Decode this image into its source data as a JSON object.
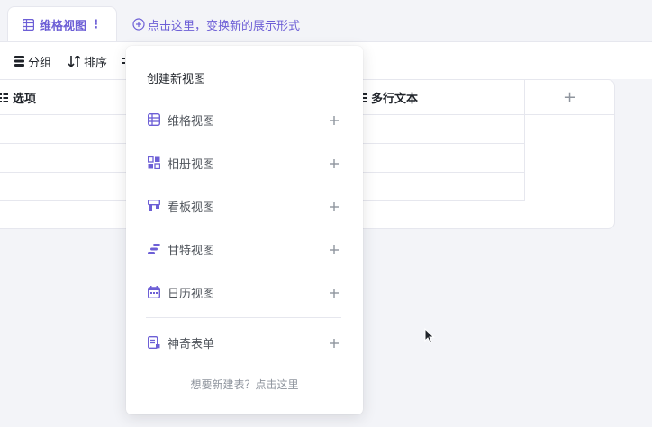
{
  "tabs": {
    "active_label": "维格视图",
    "more_glyph": "⋮",
    "add_link": "点击这里，变换新的展示形式"
  },
  "toolbar": {
    "group_label": "分组",
    "sort_label": "排序"
  },
  "grid": {
    "columns": [
      {
        "label": "选项",
        "icon": "list-icon"
      },
      {
        "label": "多行文本",
        "icon": "list-icon"
      }
    ],
    "add_column_glyph": "+"
  },
  "menu": {
    "title": "创建新视图",
    "items": [
      {
        "label": "维格视图",
        "icon": "grid-view-icon"
      },
      {
        "label": "相册视图",
        "icon": "gallery-view-icon"
      },
      {
        "label": "看板视图",
        "icon": "kanban-view-icon"
      },
      {
        "label": "甘特视图",
        "icon": "gantt-view-icon"
      },
      {
        "label": "日历视图",
        "icon": "calendar-view-icon"
      },
      {
        "label": "神奇表单",
        "icon": "form-icon"
      }
    ],
    "footer": "想要新建表？点击这里"
  },
  "colors": {
    "accent": "#6d5fd6",
    "text": "#1f2329",
    "muted": "#8f959e",
    "border": "#e6e7ee",
    "background": "#f3f4f8"
  }
}
